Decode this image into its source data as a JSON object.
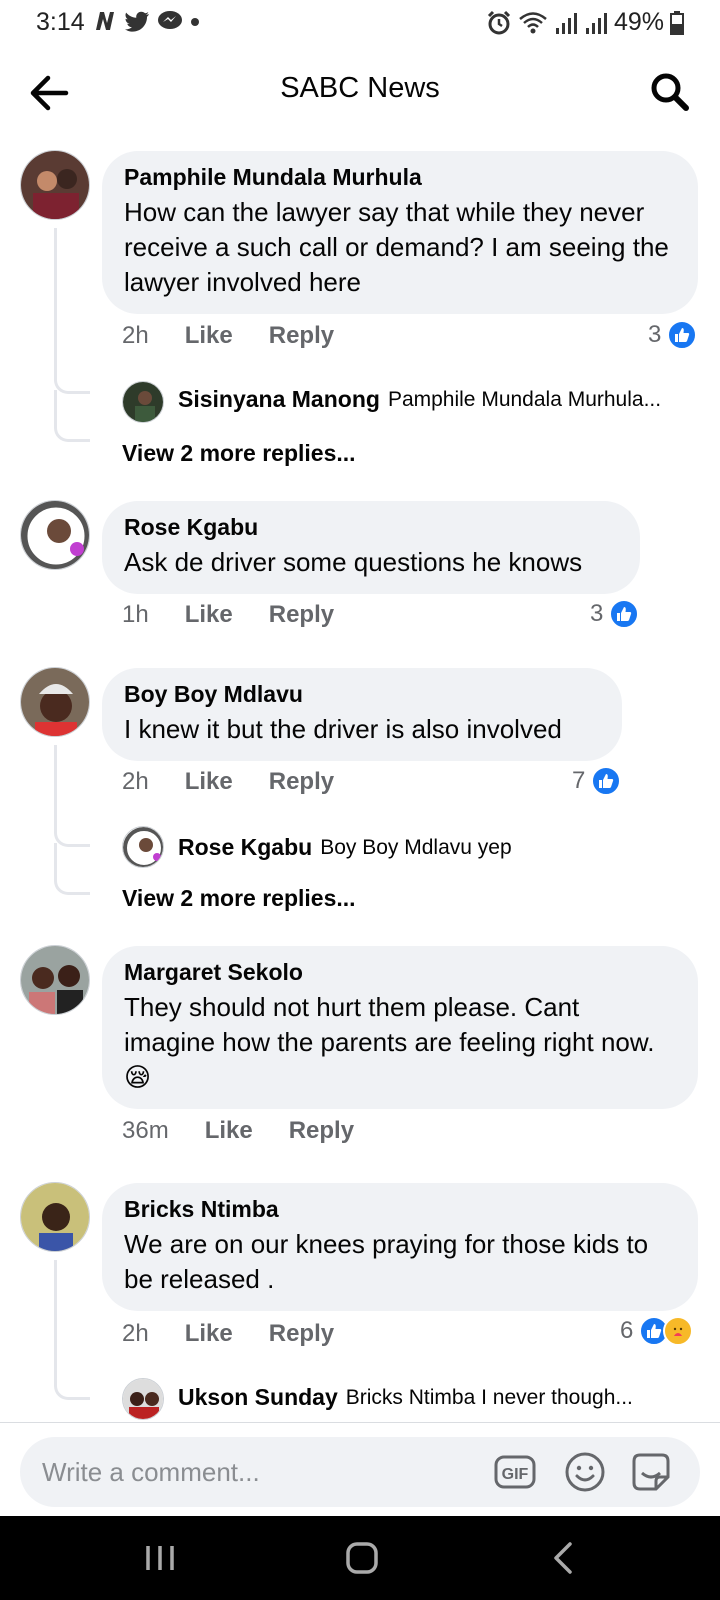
{
  "status_bar": {
    "time": "3:14",
    "battery": "49%"
  },
  "header": {
    "title": "SABC News"
  },
  "comments": [
    {
      "author": "Pamphile Mundala Murhula",
      "text": "How can the lawyer say that while they never receive a such call or demand? I am seeing the lawyer involved here",
      "time": "2h",
      "like_label": "Like",
      "reply_label": "Reply",
      "reactions": "3",
      "reply": {
        "author": "Sisinyana Manong",
        "text": "Pamphile Mundala Murhula..."
      },
      "more_replies": "View 2 more replies..."
    },
    {
      "author": "Rose Kgabu",
      "text": "Ask de driver some questions he knows",
      "time": "1h",
      "like_label": "Like",
      "reply_label": "Reply",
      "reactions": "3"
    },
    {
      "author": "Boy Boy Mdlavu",
      "text": "I knew it but the driver is also involved",
      "time": "2h",
      "like_label": "Like",
      "reply_label": "Reply",
      "reactions": "7",
      "reply": {
        "author": "Rose Kgabu",
        "text": "Boy Boy Mdlavu yep"
      },
      "more_replies": "View 2 more replies..."
    },
    {
      "author": "Margaret Sekolo",
      "text": "They should not hurt them please. Cant imagine how the parents are feeling right now.",
      "emoji": "😪",
      "time": "36m",
      "like_label": "Like",
      "reply_label": "Reply"
    },
    {
      "author": "Bricks Ntimba",
      "text": "We are on our knees praying for those kids to be released .",
      "time": "2h",
      "like_label": "Like",
      "reply_label": "Reply",
      "reactions": "6",
      "reply": {
        "author": "Ukson Sunday",
        "text": "Bricks Ntimba I never though..."
      }
    }
  ],
  "composer": {
    "placeholder": "Write a comment..."
  },
  "colors": {
    "accent": "#1877f2",
    "bubble": "#f0f2f5",
    "muted": "#65676b"
  }
}
